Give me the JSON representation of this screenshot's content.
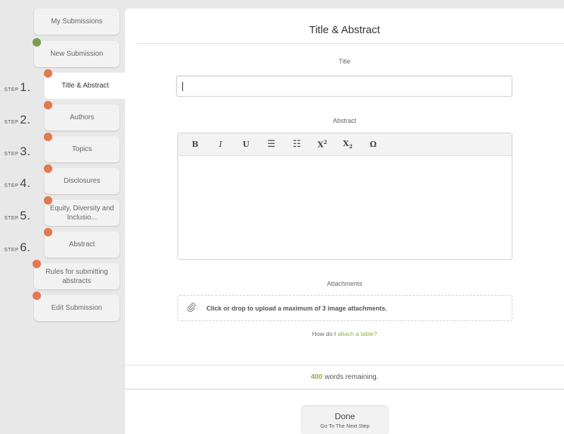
{
  "sidebar": {
    "my_submissions": "My Submissions",
    "new_submission": "New Submission",
    "step_word": "STEP",
    "steps": [
      {
        "num": "1.",
        "label": "Title & Abstract"
      },
      {
        "num": "2.",
        "label": "Authors"
      },
      {
        "num": "3.",
        "label": "Topics"
      },
      {
        "num": "4.",
        "label": "Disclosures"
      },
      {
        "num": "5.",
        "label": "Equity, Diversity and Inclusio..."
      },
      {
        "num": "6.",
        "label": "Abstract"
      }
    ],
    "rules": "Rules for submitting abstracts",
    "edit_submission": "Edit Submission"
  },
  "main": {
    "page_title": "Title & Abstract",
    "title_label": "Title",
    "title_value": "",
    "abstract_label": "Abstract",
    "toolbar": {
      "bold": "B",
      "italic": "I",
      "underline": "U",
      "bullet_list": "☰",
      "numbered_list": "☷",
      "superscript": "X",
      "superscript_mark": "2",
      "subscript": "X",
      "subscript_mark": "2",
      "special_char": "Ω"
    },
    "attachments_label": "Attachments",
    "attach_text": "Click or drop to upload a maximum of 3 image attachments.",
    "howto_prefix": "How do I ",
    "howto_link": "attach a table?",
    "words_count": "400",
    "words_text": "words remaining.",
    "done_label": "Done",
    "done_sub": "Go To The Next Step"
  },
  "colors": {
    "accent_green": "#8db33d",
    "dot_orange": "#e07a53",
    "dot_green": "#7c9a4c"
  }
}
